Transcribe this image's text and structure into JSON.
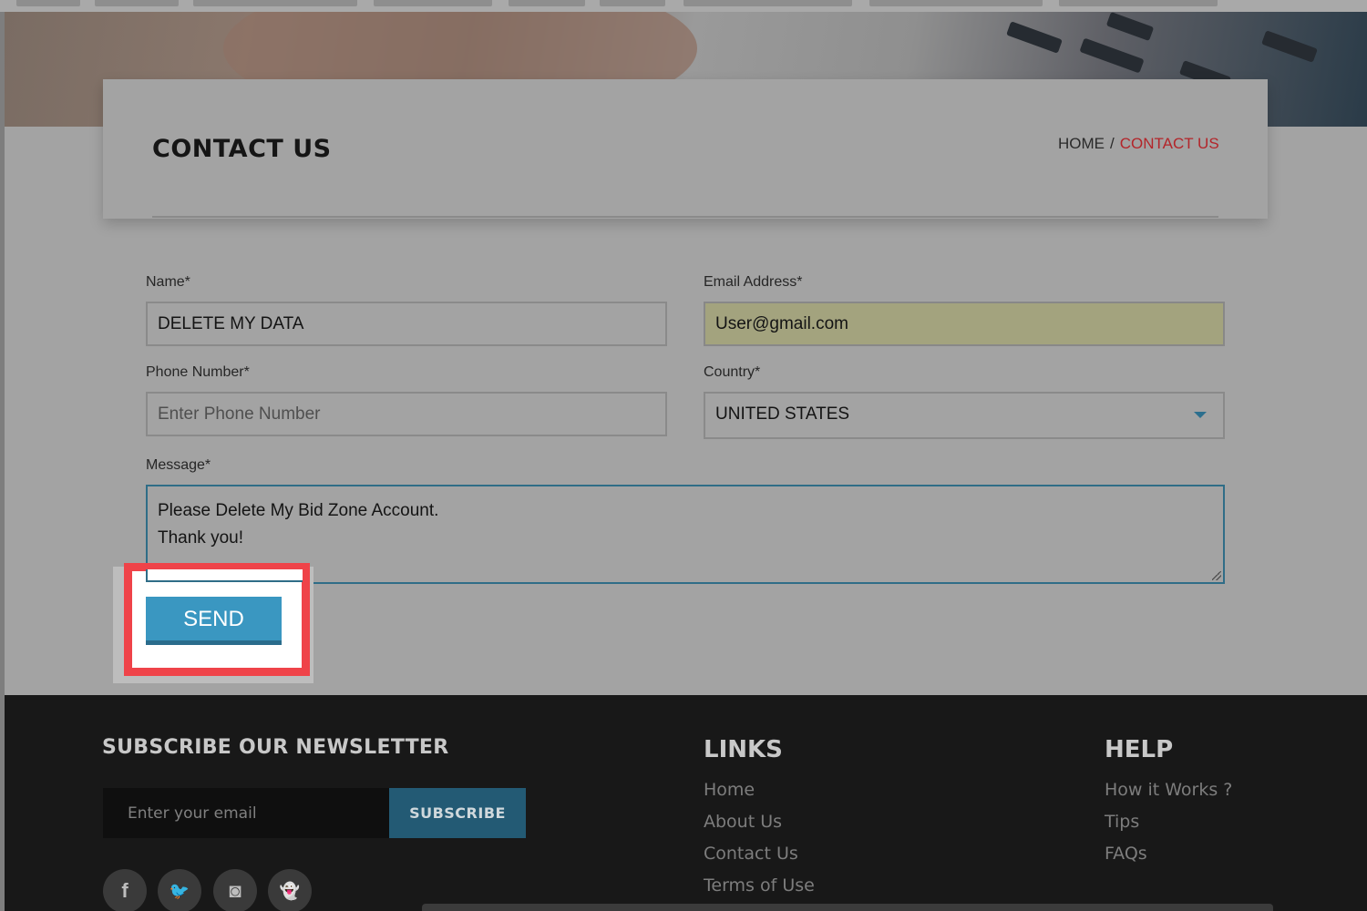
{
  "page": {
    "title": "CONTACT US",
    "breadcrumb": {
      "home": "HOME",
      "separator": "/",
      "current": "CONTACT US"
    }
  },
  "form": {
    "name": {
      "label": "Name*",
      "value": "DELETE MY DATA"
    },
    "email": {
      "label": "Email Address*",
      "value": "User@gmail.com"
    },
    "phone": {
      "label": "Phone Number*",
      "placeholder": "Enter Phone Number",
      "value": ""
    },
    "country": {
      "label": "Country*",
      "value": "UNITED STATES"
    },
    "message": {
      "label": "Message*",
      "lines": [
        "Please Delete My Bid Zone Account.",
        "Thank you!"
      ]
    },
    "send_label": "SEND"
  },
  "footer": {
    "newsletter": {
      "title": "SUBSCRIBE OUR NEWSLETTER",
      "placeholder": "Enter your email",
      "button": "SUBSCRIBE"
    },
    "social": [
      {
        "icon": "facebook-icon",
        "glyph": "f"
      },
      {
        "icon": "twitter-icon",
        "glyph": "🐦"
      },
      {
        "icon": "instagram-icon",
        "glyph": "◙"
      },
      {
        "icon": "snapchat-icon",
        "glyph": "👻"
      }
    ],
    "links": {
      "title": "LINKS",
      "items": [
        "Home",
        "About Us",
        "Contact Us",
        "Terms of Use"
      ]
    },
    "help": {
      "title": "HELP",
      "items": [
        "How it Works ?",
        "Tips",
        "FAQs"
      ]
    }
  },
  "colors": {
    "accent": "#3a97c1",
    "breadcrumb_active": "#b3252a",
    "highlight": "#ef4349",
    "footer_bg": "#181818"
  }
}
